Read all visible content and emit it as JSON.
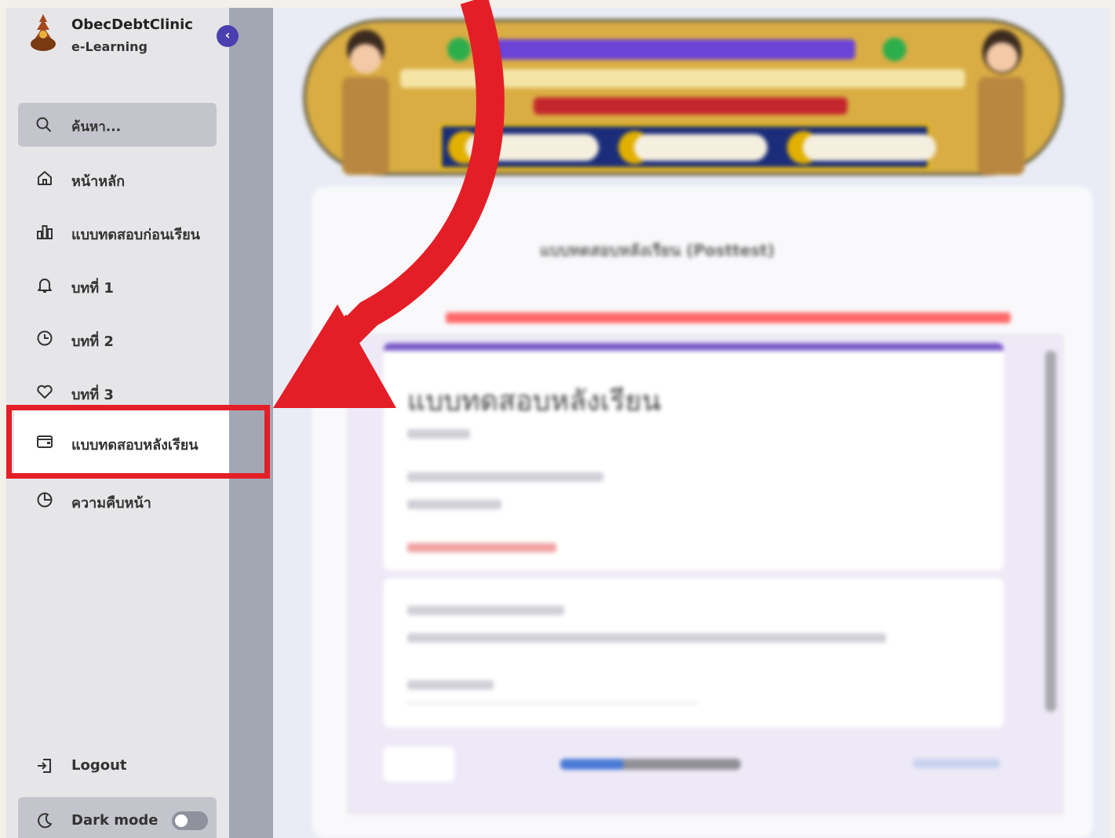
{
  "brand": {
    "title": "ObecDebtClinic",
    "subtitle": "e-Learning",
    "collapse_glyph": "‹"
  },
  "search": {
    "placeholder": "ค้นหา..."
  },
  "nav": [
    {
      "label": "หน้าหลัก",
      "icon": "home-icon"
    },
    {
      "label": "แบบทดสอบก่อนเรียน",
      "icon": "bar-chart-icon"
    },
    {
      "label": "บทที่ 1",
      "icon": "bell-icon"
    },
    {
      "label": "บทที่ 2",
      "icon": "clock-icon"
    },
    {
      "label": "บทที่ 3",
      "icon": "heart-icon"
    },
    {
      "label": "แบบทดสอบหลังเรียน",
      "icon": "wallet-icon",
      "active": true
    },
    {
      "label": "ความคืบหน้า",
      "icon": "pie-chart-icon"
    }
  ],
  "footer": {
    "logout": "Logout",
    "dark_mode": "Dark mode",
    "dark_mode_on": false
  },
  "main": {
    "card_title": "แบบทดสอบหลังเรียน (Posttest)",
    "form_title": "แบบทดสอบหลังเรียน",
    "progress_fraction": 0.35
  },
  "colors": {
    "accent": "#4b3fb0",
    "highlight": "#e41e26",
    "form_accent": "#7a5cc9"
  }
}
